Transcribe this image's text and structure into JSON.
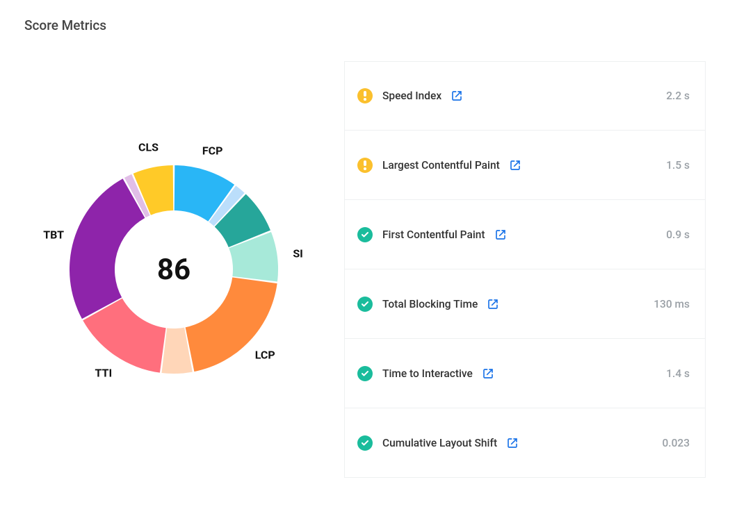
{
  "title": "Score Metrics",
  "score": "86",
  "colors": {
    "warn": "#fbc02d",
    "good": "#1abc9c",
    "link": "#1a73e8"
  },
  "chart_data": {
    "type": "donut",
    "title": "Score Metrics",
    "center_value": 86,
    "series": [
      {
        "name": "FCP",
        "label": "FCP",
        "value": 10,
        "color": "#29b6f6"
      },
      {
        "name": "FCP_pale",
        "label": "",
        "value": 2,
        "color": "#bbdefb"
      },
      {
        "name": "SI_dark",
        "label": "",
        "value": 7,
        "color": "#26a69a"
      },
      {
        "name": "SI",
        "label": "SI",
        "value": 8,
        "color": "#a7e9d9"
      },
      {
        "name": "LCP",
        "label": "LCP",
        "value": 20,
        "color": "#ff8a3c"
      },
      {
        "name": "LCP_pale",
        "label": "",
        "value": 5,
        "color": "#ffd6b8"
      },
      {
        "name": "TTI",
        "label": "TTI",
        "value": 15,
        "color": "#ff6f7d"
      },
      {
        "name": "TBT",
        "label": "TBT",
        "value": 25,
        "color": "#8e24aa"
      },
      {
        "name": "TBT_pale",
        "label": "",
        "value": 1.5,
        "color": "#e1bee7"
      },
      {
        "name": "CLS",
        "label": "CLS",
        "value": 6.5,
        "color": "#ffca28"
      }
    ]
  },
  "metrics": [
    {
      "status": "warn",
      "name": "Speed Index",
      "value": "2.2 s"
    },
    {
      "status": "warn",
      "name": "Largest Contentful Paint",
      "value": "1.5 s"
    },
    {
      "status": "good",
      "name": "First Contentful Paint",
      "value": "0.9 s"
    },
    {
      "status": "good",
      "name": "Total Blocking Time",
      "value": "130 ms"
    },
    {
      "status": "good",
      "name": "Time to Interactive",
      "value": "1.4 s"
    },
    {
      "status": "good",
      "name": "Cumulative Layout Shift",
      "value": "0.023"
    }
  ]
}
